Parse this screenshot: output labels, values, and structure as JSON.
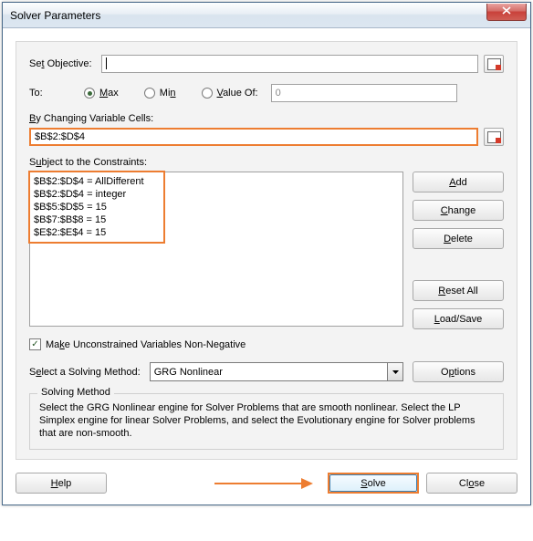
{
  "window": {
    "title": "Solver Parameters"
  },
  "objective": {
    "label_pre": "Se",
    "label_u": "t",
    "label_post": " Objective:",
    "value": ""
  },
  "to": {
    "label": "To:",
    "max_u": "M",
    "max_post": "ax",
    "min_pre": "Mi",
    "min_u": "n",
    "valof_u": "V",
    "valof_post": "alue Of:",
    "valof_value": "0",
    "selected": "max"
  },
  "varcells": {
    "label_u": "B",
    "label_post": "y Changing Variable Cells:",
    "value": "$B$2:$D$4"
  },
  "constraints": {
    "label_pre": "S",
    "label_u": "u",
    "label_post": "bject to the Constraints:",
    "items": [
      "$B$2:$D$4 = AllDifferent",
      "$B$2:$D$4 = integer",
      "$B$5:$D$5 = 15",
      "$B$7:$B$8 = 15",
      "$E$2:$E$4 = 15"
    ]
  },
  "buttons": {
    "add_u": "A",
    "add_post": "dd",
    "change_u": "C",
    "change_post": "hange",
    "delete_u": "D",
    "delete_post": "elete",
    "reset_u": "R",
    "reset_post": "eset All",
    "load_u": "L",
    "load_post": "oad/Save",
    "options_pre": "O",
    "options_u": "p",
    "options_post": "tions",
    "help_u": "H",
    "help_post": "elp",
    "solve_u": "S",
    "solve_post": "olve",
    "close_pre": "Cl",
    "close_u": "o",
    "close_post": "se"
  },
  "nonneg": {
    "pre": "Ma",
    "u": "k",
    "post": "e Unconstrained Variables Non-Negative",
    "checked": true
  },
  "method": {
    "label_pre": "S",
    "label_u": "e",
    "label_post": "lect a Solving Method:",
    "value": "GRG Nonlinear"
  },
  "methodbox": {
    "title": "Solving Method",
    "desc": "Select the GRG Nonlinear engine for Solver Problems that are smooth nonlinear. Select the LP Simplex engine for linear Solver Problems, and select the Evolutionary engine for Solver problems that are non-smooth."
  }
}
